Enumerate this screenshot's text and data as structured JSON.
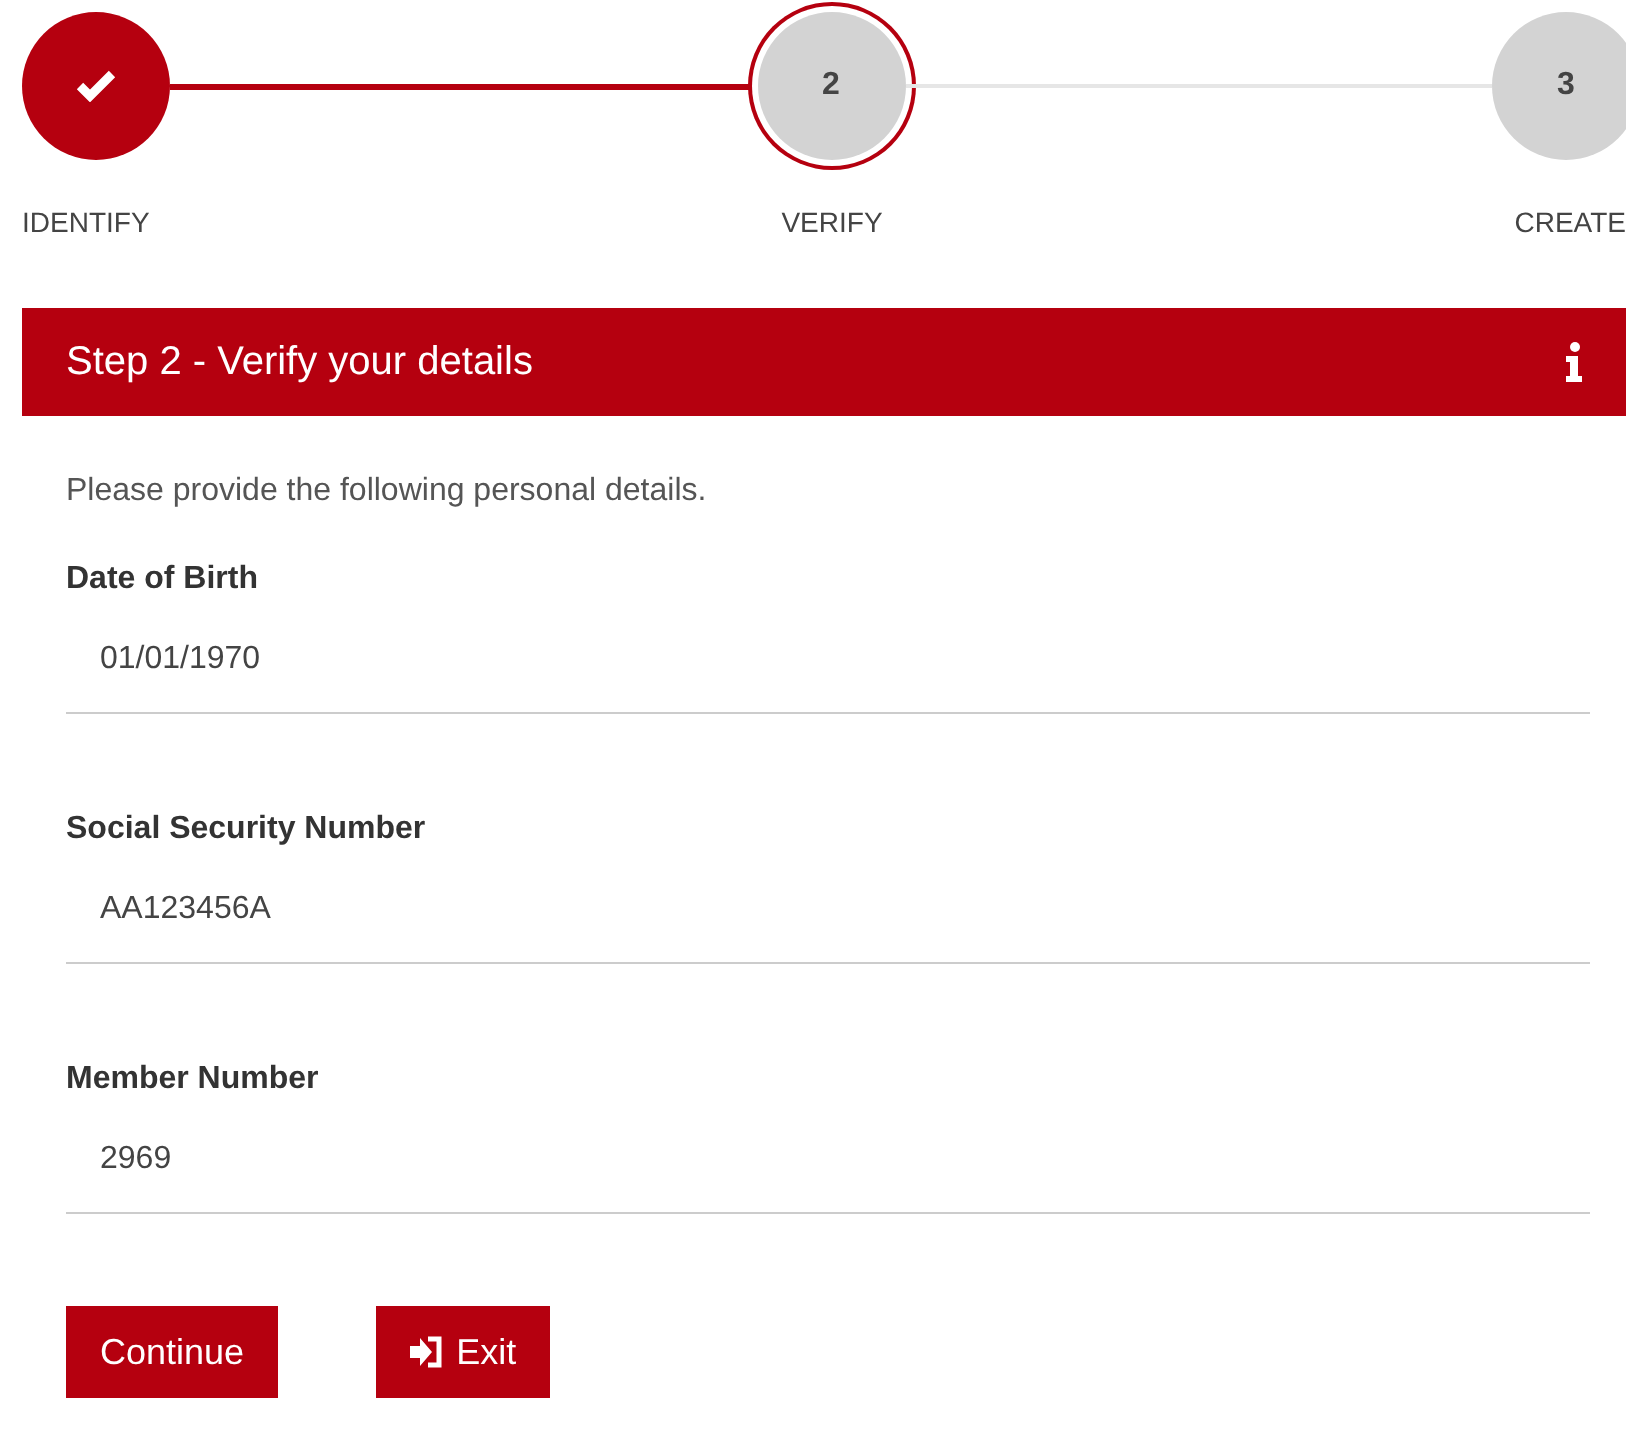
{
  "steps": [
    {
      "label": "IDENTIFY",
      "done": true,
      "selected": false
    },
    {
      "number": "2",
      "label": "VERIFY",
      "done": false,
      "selected": true
    },
    {
      "number": "3",
      "label": "CREATE",
      "done": false,
      "selected": false
    }
  ],
  "panel": {
    "title": "Step 2 - Verify your details",
    "intro": "Please provide the following personal details."
  },
  "fields": [
    {
      "label": "Date of Birth",
      "value": "01/01/1970"
    },
    {
      "label": "Social Security Number",
      "value": "AA123456A"
    },
    {
      "label": "Member Number",
      "value": "2969"
    }
  ],
  "buttons": [
    {
      "label": "Continue",
      "kind": "primary"
    },
    {
      "label": "Exit",
      "kind": "exit"
    }
  ]
}
